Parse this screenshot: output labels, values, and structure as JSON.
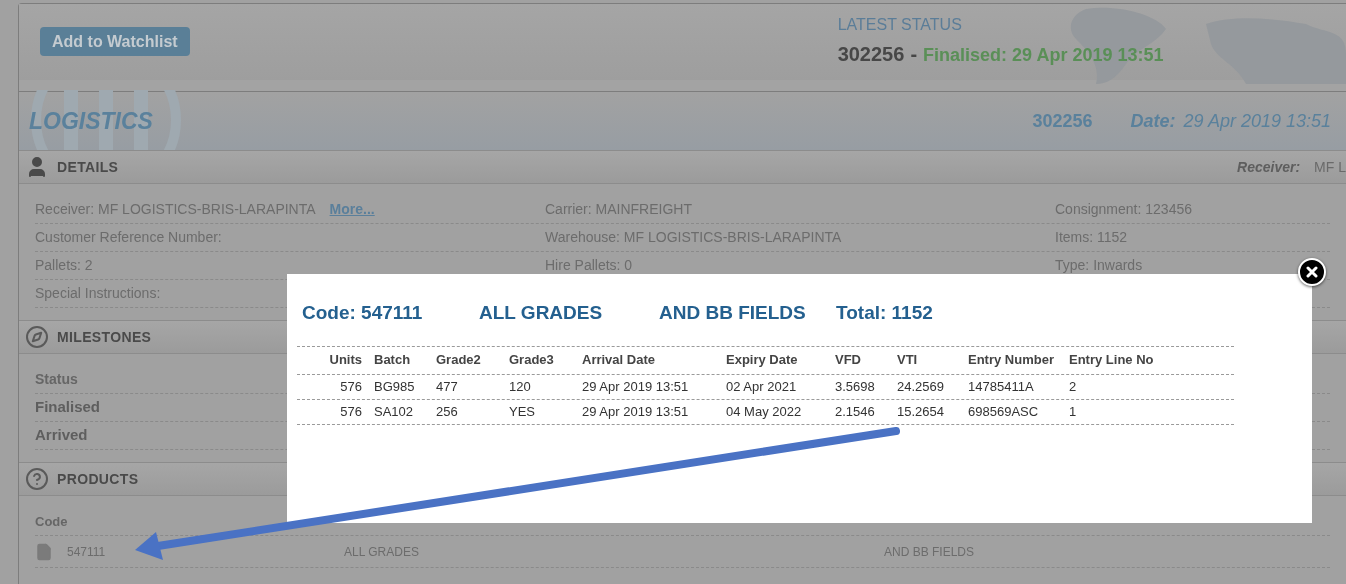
{
  "header": {
    "watchlist_button": "Add to Watchlist",
    "latest_status": {
      "label": "LATEST STATUS",
      "number": "302256",
      "separator": "-",
      "status": "Finalised: 29 Apr 2019 13:51"
    }
  },
  "banner": {
    "title": "LOGISTICS",
    "number": "302256",
    "date_label": "Date:",
    "date": "29 Apr 2019 13:51"
  },
  "details": {
    "title": "DETAILS",
    "receiver_label": "Receiver:",
    "receiver_value": "MF L",
    "rows": [
      [
        {
          "text": "Receiver: MF LOGISTICS-BRIS-LARAPINTA",
          "link": "More..."
        },
        {
          "text": "Carrier: MAINFREIGHT"
        },
        {
          "text": "Consignment:  123456"
        }
      ],
      [
        {
          "text": "Customer Reference Number:"
        },
        {
          "text": "Warehouse: MF LOGISTICS-BRIS-LARAPINTA"
        },
        {
          "text": "Items: 1152"
        }
      ],
      [
        {
          "text": "Pallets: 2"
        },
        {
          "text": "Hire Pallets: 0"
        },
        {
          "text": "Type: Inwards"
        }
      ],
      [
        {
          "text": "Special Instructions:"
        }
      ]
    ]
  },
  "milestones": {
    "title": "MILESTONES",
    "column": "Status",
    "rows": [
      "Finalised",
      "Arrived"
    ]
  },
  "products": {
    "title": "PRODUCTS",
    "column": "Code",
    "rows": [
      {
        "code": "547111",
        "description_1": "ALL GRADES",
        "description_2": "AND BB FIELDS"
      }
    ]
  },
  "modal": {
    "code": "Code: 547111",
    "description_1": "ALL GRADES",
    "description_2": "AND BB FIELDS",
    "total": "Total: 1152",
    "columns": [
      "Units",
      "Batch",
      "Grade2",
      "Grade3",
      "Arrival Date",
      "Expiry Date",
      "VFD",
      "VTI",
      "Entry Number",
      "Entry Line No"
    ],
    "rows": [
      [
        "576",
        "BG985",
        "477",
        "120",
        "29 Apr 2019 13:51",
        "02 Apr 2021",
        "3.5698",
        "24.2569",
        "14785411A",
        "2"
      ],
      [
        "576",
        "SA102",
        "256",
        "YES",
        "29 Apr 2019 13:51",
        "04 May 2022",
        "2.1546",
        "15.2654",
        "698569ASC",
        "1"
      ]
    ]
  }
}
